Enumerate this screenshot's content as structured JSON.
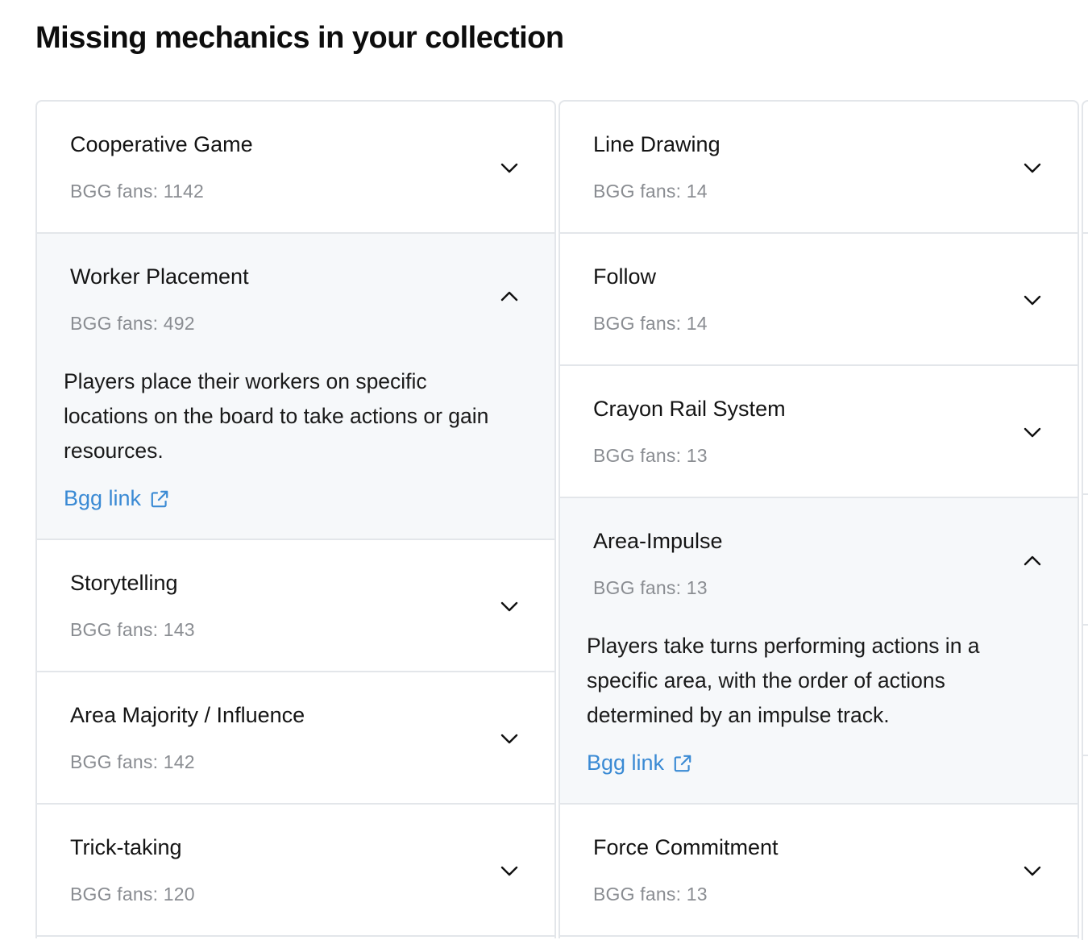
{
  "page": {
    "title": "Missing mechanics in your collection"
  },
  "colors": {
    "link": "#3a8ad4",
    "expanded_bg": "#f6f8fa",
    "border": "#e3e6ea",
    "muted": "#8a8d92"
  },
  "left_column": [
    {
      "title": "Cooperative Game",
      "fans": "BGG fans: 1142",
      "expanded": false,
      "icon": "chevron-down-icon"
    },
    {
      "title": "Worker Placement",
      "fans": "BGG fans: 492",
      "expanded": true,
      "icon": "chevron-up-icon",
      "description": "Players place their workers on specific locations on the board to take actions or gain resources.",
      "link_label": "Bgg link",
      "link_icon": "external-link-icon"
    },
    {
      "title": "Storytelling",
      "fans": "BGG fans: 143",
      "expanded": false,
      "icon": "chevron-down-icon"
    },
    {
      "title": "Area Majority / Influence",
      "fans": "BGG fans: 142",
      "expanded": false,
      "icon": "chevron-down-icon"
    },
    {
      "title": "Trick-taking",
      "fans": "BGG fans: 120",
      "expanded": false,
      "icon": "chevron-down-icon"
    }
  ],
  "right_column": [
    {
      "title": "Line Drawing",
      "fans": "BGG fans: 14",
      "expanded": false,
      "icon": "chevron-down-icon"
    },
    {
      "title": "Follow",
      "fans": "BGG fans: 14",
      "expanded": false,
      "icon": "chevron-down-icon"
    },
    {
      "title": "Crayon Rail System",
      "fans": "BGG fans: 13",
      "expanded": false,
      "icon": "chevron-down-icon"
    },
    {
      "title": "Area-Impulse",
      "fans": "BGG fans: 13",
      "expanded": true,
      "icon": "chevron-up-icon",
      "description": "Players take turns performing actions in a specific area, with the order of actions determined by an impulse track.",
      "link_label": "Bgg link",
      "link_icon": "external-link-icon"
    },
    {
      "title": "Force Commitment",
      "fans": "BGG fans: 13",
      "expanded": false,
      "icon": "chevron-down-icon"
    }
  ]
}
